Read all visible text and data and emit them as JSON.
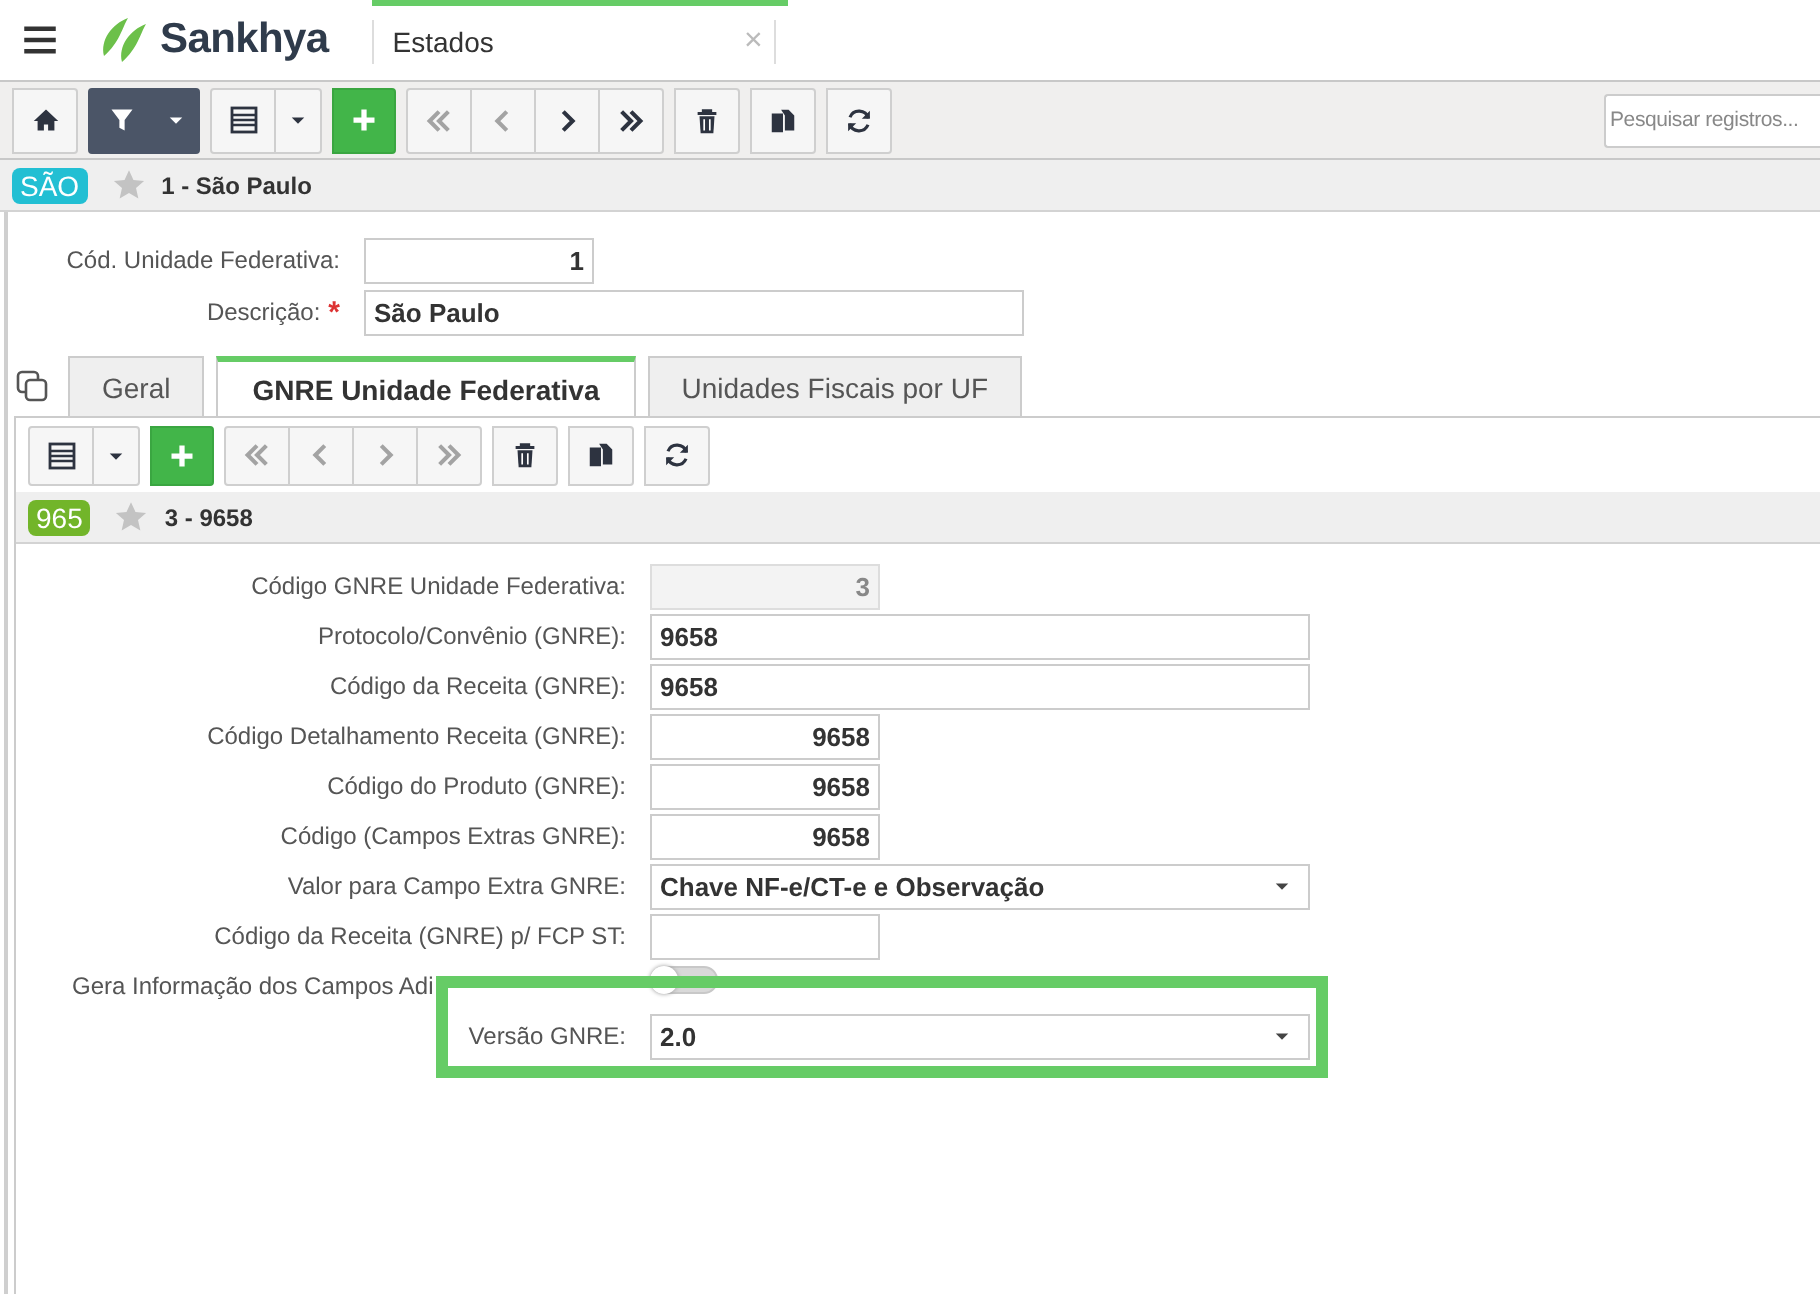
{
  "header": {
    "app_name": "Sankhya",
    "tab": {
      "title": "Estados",
      "close": "×"
    }
  },
  "toolbar": {
    "groups": [
      {
        "buttons": [
          {
            "kind": "home",
            "active": false,
            "disabled": false
          }
        ]
      },
      {
        "buttons": [
          {
            "kind": "filter",
            "active": true,
            "disabled": false
          },
          {
            "kind": "dropdown",
            "active": true,
            "disabled": false
          }
        ]
      },
      {
        "buttons": [
          {
            "kind": "grid",
            "active": false,
            "disabled": false
          },
          {
            "kind": "dropdown",
            "active": false,
            "disabled": false
          }
        ]
      },
      {
        "buttons": [
          {
            "kind": "add",
            "active": false,
            "disabled": false
          }
        ]
      },
      {
        "buttons": [
          {
            "kind": "first",
            "active": false,
            "disabled": true
          },
          {
            "kind": "previous",
            "active": false,
            "disabled": true
          },
          {
            "kind": "next",
            "active": false,
            "disabled": false
          },
          {
            "kind": "last",
            "active": false,
            "disabled": false
          }
        ]
      },
      {
        "buttons": [
          {
            "kind": "delete",
            "active": false,
            "disabled": false
          }
        ]
      },
      {
        "buttons": [
          {
            "kind": "duplicate",
            "active": false,
            "disabled": false
          }
        ]
      },
      {
        "buttons": [
          {
            "kind": "refresh",
            "active": false,
            "disabled": false
          }
        ]
      }
    ],
    "search": {
      "placeholder": "Pesquisar registros..."
    }
  },
  "record": {
    "badge": "SÃO",
    "color": "#22bfd3",
    "title": "1 - São Paulo"
  },
  "fields": [
    {
      "kind": "number",
      "label": "Cód. Unidade Federativa:",
      "value": "1",
      "disabled": false,
      "highlighted": false
    },
    {
      "kind": "text",
      "label": "Descrição:",
      "required_mark": "*",
      "value": "São Paulo",
      "disabled": false,
      "highlighted": false
    }
  ],
  "tabs": [
    {
      "label": "Geral",
      "selected": false
    },
    {
      "label": "GNRE Unidade Federativa",
      "selected": true
    },
    {
      "label": "Unidades Fiscais por UF",
      "selected": false
    }
  ],
  "detail": {
    "toolbar": {
      "groups": [
        {
          "buttons": [
            {
              "kind": "grid",
              "active": false,
              "disabled": false
            },
            {
              "kind": "dropdown",
              "active": false,
              "disabled": false
            }
          ]
        },
        {
          "buttons": [
            {
              "kind": "add",
              "active": false,
              "disabled": false
            }
          ]
        },
        {
          "buttons": [
            {
              "kind": "first",
              "active": false,
              "disabled": true
            },
            {
              "kind": "previous",
              "active": false,
              "disabled": true
            },
            {
              "kind": "next",
              "active": false,
              "disabled": true
            },
            {
              "kind": "last",
              "active": false,
              "disabled": true
            }
          ]
        },
        {
          "buttons": [
            {
              "kind": "delete",
              "active": false,
              "disabled": false
            }
          ]
        },
        {
          "buttons": [
            {
              "kind": "duplicate",
              "active": false,
              "disabled": false
            }
          ]
        },
        {
          "buttons": [
            {
              "kind": "refresh",
              "active": false,
              "disabled": false
            }
          ]
        }
      ]
    },
    "record": {
      "badge": "965",
      "color": "#72b52a",
      "title": "3 - 9658"
    },
    "fields": [
      {
        "kind": "number",
        "label": "Código GNRE Unidade Federativa:",
        "value": "3",
        "disabled": true,
        "highlighted": false
      },
      {
        "kind": "text",
        "label": "Protocolo/Convênio (GNRE):",
        "value": "9658",
        "disabled": false,
        "highlighted": false
      },
      {
        "kind": "text",
        "label": "Código da Receita (GNRE):",
        "value": "9658",
        "disabled": false,
        "highlighted": false
      },
      {
        "kind": "number",
        "label": "Código Detalhamento Receita (GNRE):",
        "value": "9658",
        "disabled": false,
        "highlighted": false
      },
      {
        "kind": "number",
        "label": "Código do Produto (GNRE):",
        "value": "9658",
        "disabled": false,
        "highlighted": false
      },
      {
        "kind": "number",
        "label": "Código (Campos Extras GNRE):",
        "value": "9658",
        "disabled": false,
        "highlighted": false
      },
      {
        "kind": "select",
        "label": "Valor para Campo Extra GNRE:",
        "value": "Chave NF-e/CT-e e Observação",
        "disabled": false,
        "highlighted": false
      },
      {
        "kind": "number",
        "label": "Código da Receita (GNRE) p/ FCP ST:",
        "disabled": false,
        "highlighted": false
      },
      {
        "kind": "toggle",
        "label": "Gera Informação dos Campos Adi",
        "on": false,
        "disabled": false,
        "highlighted": false
      },
      {
        "kind": "select",
        "label": "Versão GNRE:",
        "value": "2.0",
        "disabled": false,
        "highlighted": true
      }
    ]
  }
}
